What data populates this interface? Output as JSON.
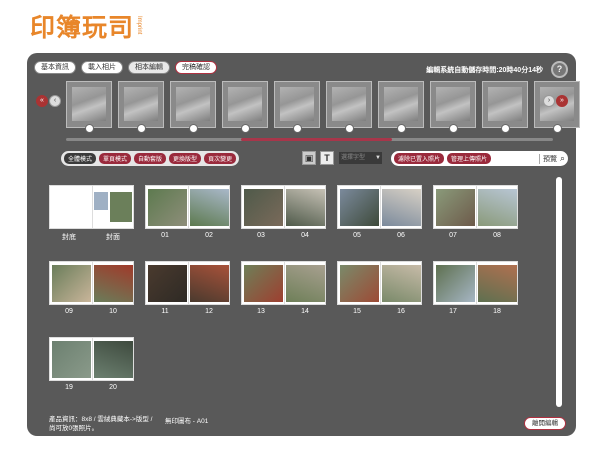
{
  "logo": {
    "text": "印簿玩司",
    "sub": "Imprint"
  },
  "header": {
    "tabs": [
      {
        "label": "基本資訊",
        "active": false
      },
      {
        "label": "載入相片",
        "active": false
      },
      {
        "label": "相本編輯",
        "active": true
      },
      {
        "label": "完稿確認",
        "active": false
      }
    ],
    "autosave": "編輯系統自動儲存時間:20時40分14秒",
    "help_icon": "?"
  },
  "toolbar": {
    "modes": [
      {
        "label": "全體模式",
        "dark": true
      },
      {
        "label": "單頁模式",
        "dark": false
      },
      {
        "label": "自動套版",
        "dark": false
      },
      {
        "label": "更換版型",
        "dark": false
      },
      {
        "label": "頁次變更",
        "dark": false
      }
    ],
    "font_select": "選擇字型",
    "filter_buttons": [
      "濾除已置入照片",
      "管理上傳照片"
    ],
    "preview": "預覽"
  },
  "spreads": [
    {
      "left": "封底",
      "right": "封面"
    },
    {
      "left": "01",
      "right": "02"
    },
    {
      "left": "03",
      "right": "04"
    },
    {
      "left": "05",
      "right": "06"
    },
    {
      "left": "07",
      "right": "08"
    },
    {
      "left": "09",
      "right": "10"
    },
    {
      "left": "11",
      "right": "12"
    },
    {
      "left": "13",
      "right": "14"
    },
    {
      "left": "15",
      "right": "16"
    },
    {
      "left": "17",
      "right": "18"
    },
    {
      "left": "19",
      "right": "20"
    }
  ],
  "footer": {
    "product_line1": "產品資訊：8x8 / 雲絨典藏本->版型 /",
    "product_line2": "尚可放0張照片。",
    "layout_code": "無印圖布 - A01",
    "close_label": "離開編輯"
  }
}
